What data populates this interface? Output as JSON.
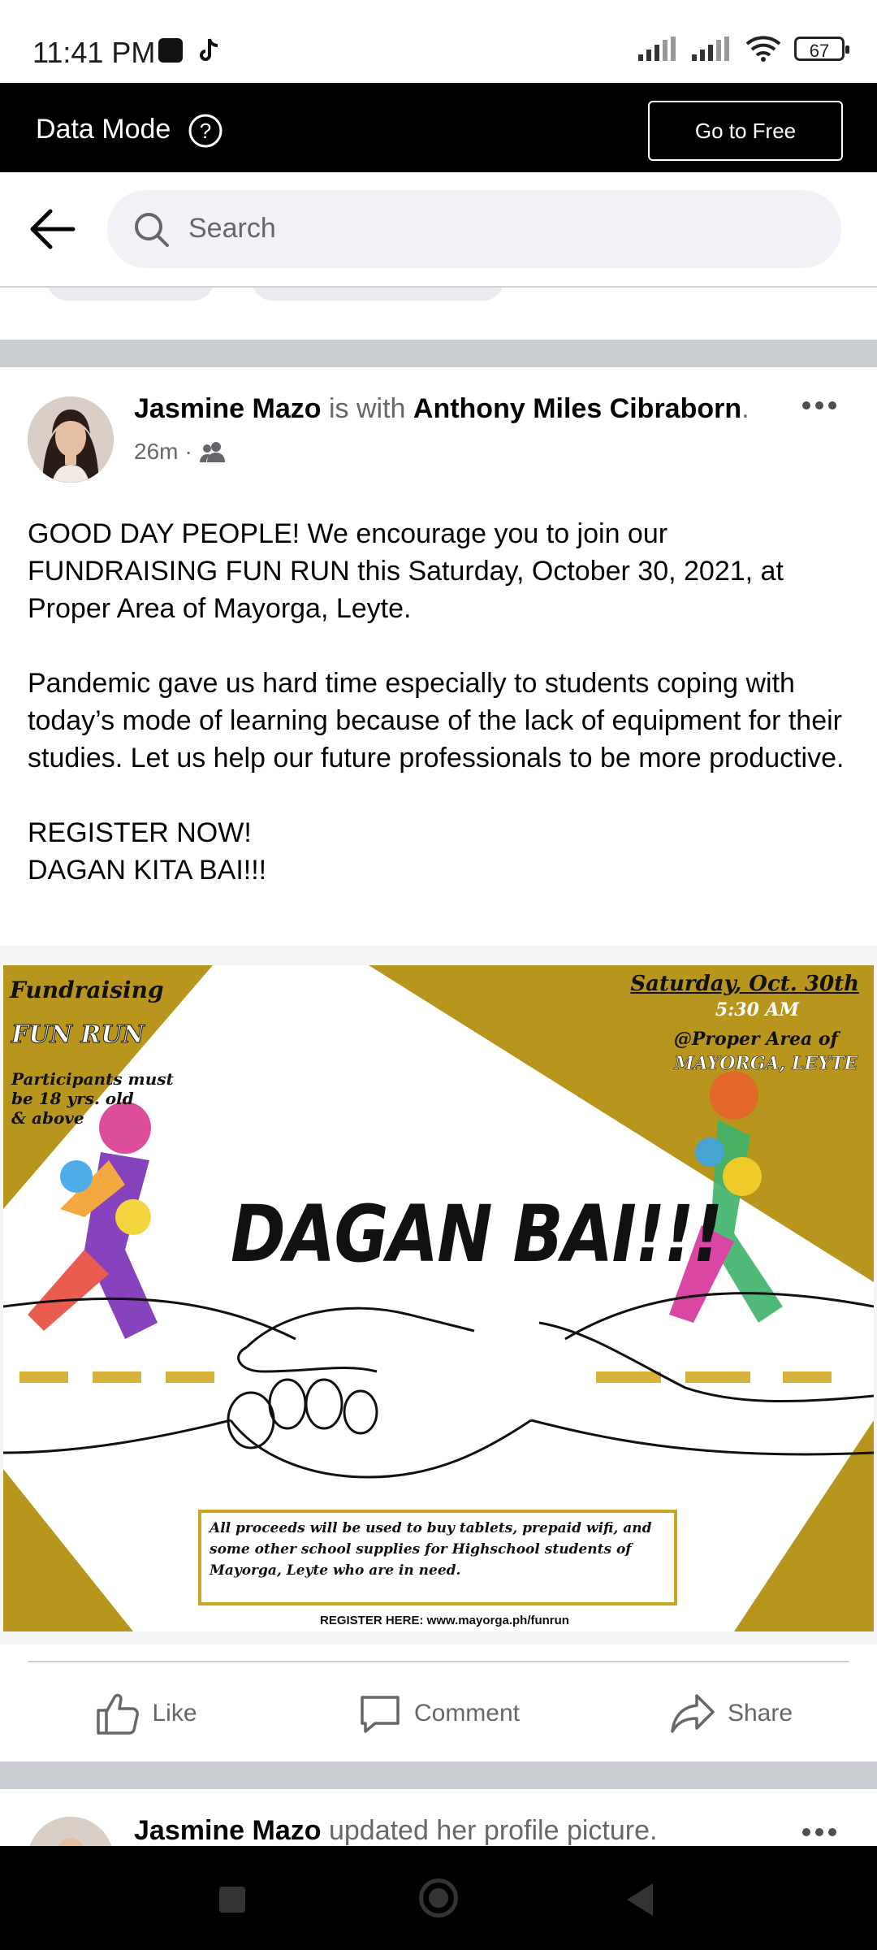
{
  "status_bar": {
    "time": "11:41 PM",
    "battery": "67"
  },
  "data_mode": {
    "title": "Data Mode",
    "help_symbol": "?",
    "cta": "Go to Free"
  },
  "search": {
    "placeholder": "Search"
  },
  "post": {
    "author": "Jasmine Mazo",
    "with_text": " is with ",
    "tagged": "Anthony Miles Cibraborn",
    "period": ".",
    "time": "26m",
    "audience_icon": "friends-icon",
    "paragraphs": [
      "GOOD DAY PEOPLE! We encourage you to join our FUNDRAISING FUN RUN this Saturday, October 30, 2021, at Proper Area of Mayorga, Leyte.",
      "Pandemic gave us hard time especially to students coping with today’s mode of learning because of the lack of equipment for their studies.  Let us help our future professionals to be more productive.",
      "REGISTER NOW!",
      "DAGAN KITA BAI!!!"
    ],
    "poster": {
      "top_left_1": "Fundraising",
      "top_left_2": "FUN RUN",
      "participants": [
        "Participants must",
        "be 18 yrs. old",
        "& above"
      ],
      "date": "Saturday, Oct. 30th",
      "time": "5:30 AM",
      "location_1": "@Proper Area of",
      "location_2": "MAYORGA, LEYTE",
      "headline": "DAGAN BAI!!!",
      "box_text": "All proceeds will be used to buy tablets, prepaid wifi, and some other school supplies for Highschool students of Mayorga, Leyte who are in need.",
      "register": "REGISTER HERE: www.mayorga.ph/funrun"
    },
    "actions": {
      "like": "Like",
      "comment": "Comment",
      "share": "Share"
    }
  },
  "next_post": {
    "author": "Jasmine Mazo",
    "action": " updated her profile picture."
  }
}
